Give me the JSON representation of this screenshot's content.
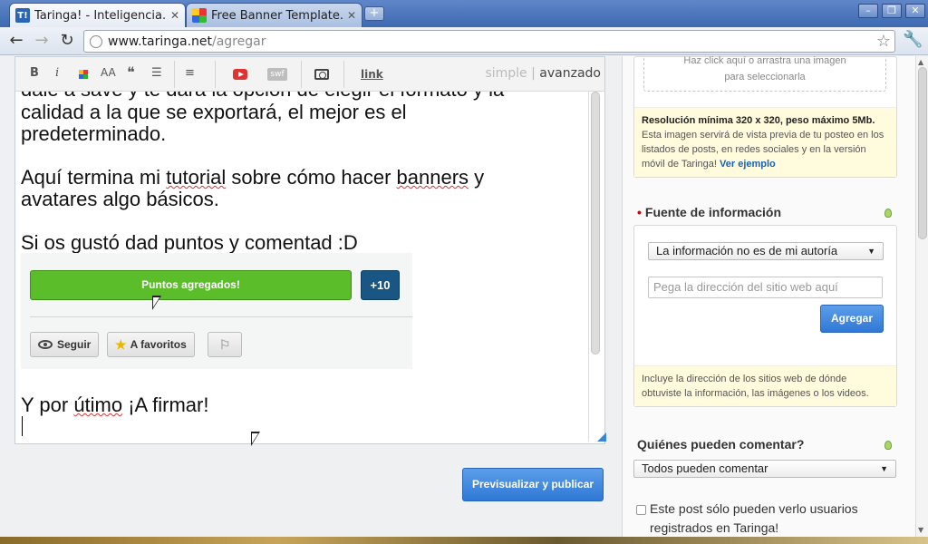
{
  "browser": {
    "tabs": [
      {
        "title": "Taringa! - Inteligencia...",
        "favicon": "taringa-icon"
      },
      {
        "title": "Free Banner Template...",
        "favicon": "banner-icon"
      }
    ],
    "new_tab_label": "+",
    "window_buttons": [
      "–",
      "❐",
      "✕"
    ],
    "url_host": "www.taringa.net",
    "url_path": "/agregar"
  },
  "editor": {
    "toolbar": {
      "bold": "B",
      "italic": "i",
      "font_size": "AA",
      "quote": "❝",
      "list": "☰",
      "align": "≡",
      "swf": "swf",
      "link": "link",
      "mode_simple": "simple",
      "mode_sep": "|",
      "mode_advanced": "avanzado"
    },
    "content": {
      "line_partial": "dale a save y te dará la opción de elegir el formato y la",
      "line_1a": "calidad a la que se exportará, el mejor es el",
      "line_1b": "predeterminado.",
      "line_2a_pre": "Aquí termina mi ",
      "line_2a_tutorial": "tutorial",
      "line_2a_mid": " sobre cómo hacer ",
      "line_2a_banners": "banners",
      "line_2a_post": " y",
      "line_2b": "avatares algo básicos.",
      "line_3": "Si os gustó dad puntos y comentad :D",
      "line_4_pre": "Y por ",
      "line_4_utimo": "útimo",
      "line_4_post": " ¡A firmar!"
    },
    "embed": {
      "points_label": "Puntos agregados!",
      "points_badge": "+10",
      "follow_label": "Seguir",
      "favorites_label": "A favoritos",
      "flag_icon": "⚐"
    }
  },
  "publish_button": "Previsualizar y publicar",
  "sidebar": {
    "upload": {
      "dropzone_line1": "Haz click aquí o arrastra una imagen",
      "dropzone_line2": "para seleccionarla",
      "note_bold": "Resolución mínima 320 x 320, peso máximo 5Mb.",
      "note_text": "Esta imagen servirá de vista previa de tu posteo en los listados de posts, en redes sociales y en la versión móvil de Taringa!",
      "note_link": "Ver ejemplo"
    },
    "source": {
      "required_mark": "•",
      "title": "Fuente de información",
      "select_value": "La información no es de mi autoría",
      "input_placeholder": "Pega la dirección del sitio web aquí",
      "add_button": "Agregar",
      "note": "Incluye la dirección de los sitios web de dónde obtuviste la información, las imágenes o los videos."
    },
    "comments": {
      "title": "Quiénes pueden comentar?",
      "select_value": "Todos pueden comentar"
    },
    "private_checkbox_label": "Este post sólo pueden verlo usuarios registrados en Taringa!"
  }
}
